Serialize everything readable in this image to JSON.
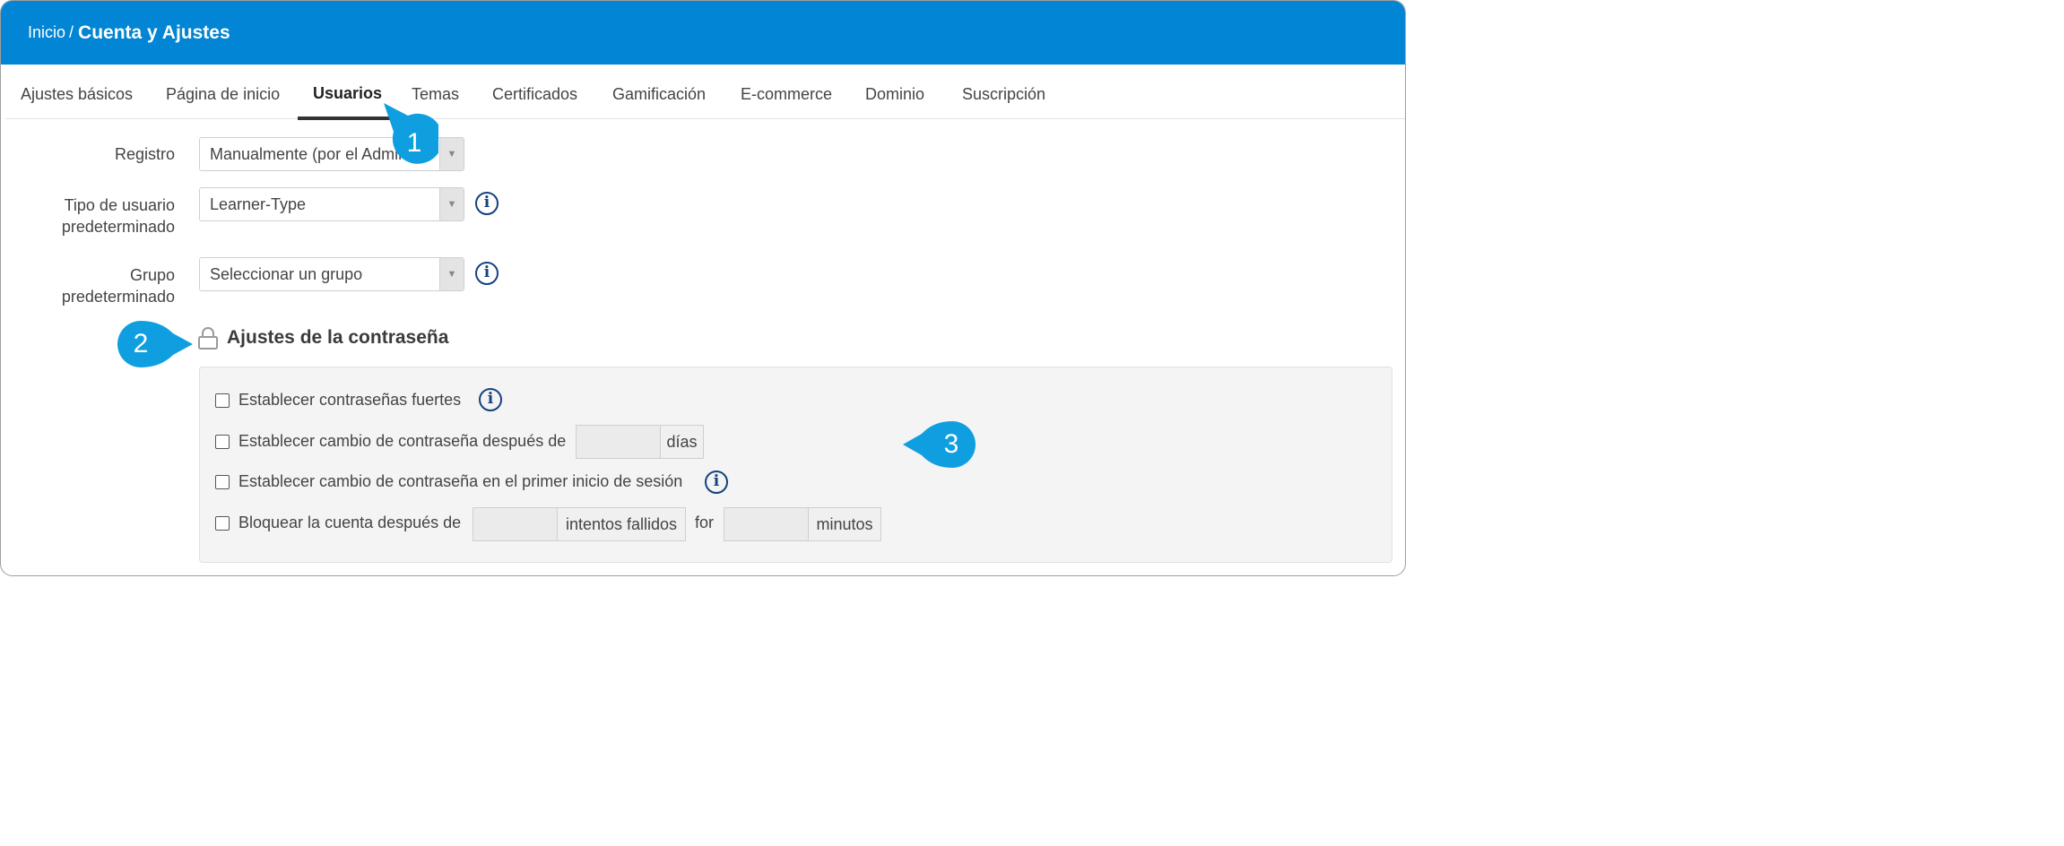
{
  "header": {
    "breadcrumb_root": "Inicio",
    "breadcrumb_separator": "/",
    "breadcrumb_current": "Cuenta y Ajustes"
  },
  "tabs": [
    {
      "label": "Ajustes básicos"
    },
    {
      "label": "Página de inicio"
    },
    {
      "label": "Usuarios",
      "active": true
    },
    {
      "label": "Temas"
    },
    {
      "label": "Certificados"
    },
    {
      "label": "Gamificación"
    },
    {
      "label": "E-commerce"
    },
    {
      "label": "Dominio"
    },
    {
      "label": "Suscripción"
    }
  ],
  "form": {
    "registro": {
      "label": "Registro",
      "value": "Manualmente (por el Admin"
    },
    "tipo_usuario": {
      "label_line1": "Tipo de usuario",
      "label_line2": "predeterminado",
      "value": "Learner-Type"
    },
    "grupo": {
      "label_line1": "Grupo",
      "label_line2": "predeterminado",
      "value": "Seleccionar un grupo"
    }
  },
  "password_section": {
    "title": "Ajustes de la contraseña",
    "options": {
      "strong": {
        "label": "Establecer contraseñas fuertes",
        "checked": false
      },
      "change_after": {
        "label": "Establecer cambio de contraseña después de",
        "unit": "días",
        "value": "",
        "checked": false
      },
      "first_login": {
        "label": "Establecer cambio de contraseña en el primer inicio de sesión",
        "checked": false
      },
      "lock_account": {
        "label": "Bloquear la cuenta después de",
        "unit1": "intentos fallidos",
        "connector": "for",
        "unit2": "minutos",
        "checked": false
      }
    }
  },
  "callouts": [
    "1",
    "2",
    "3"
  ],
  "colors": {
    "header_bg": "#0185d4",
    "callout": "#0f9fe0",
    "info_icon": "#14427e"
  },
  "icons": [
    "info-icon",
    "lock-icon",
    "chevron-down-icon"
  ]
}
